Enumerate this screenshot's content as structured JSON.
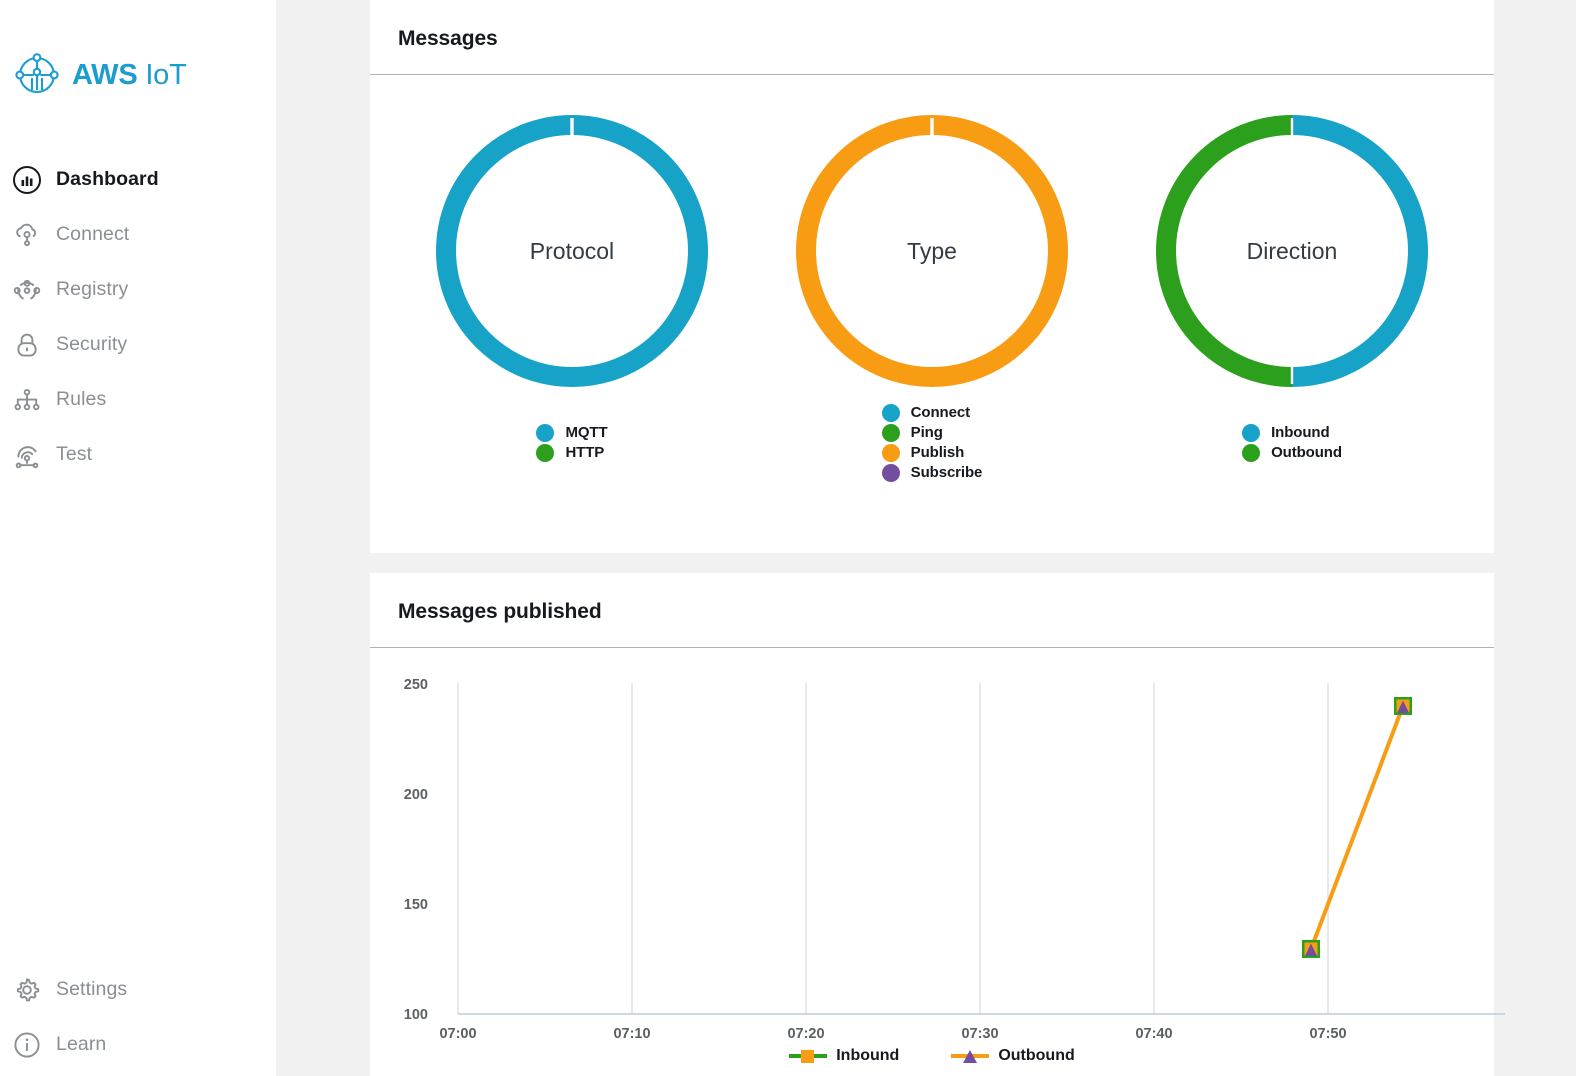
{
  "brand": {
    "primary": "AWS",
    "secondary": "IoT",
    "logo_icon": "aws-iot-logo-icon",
    "color": "#1b9dd1"
  },
  "sidebar": {
    "items": [
      {
        "label": "Dashboard",
        "icon": "dashboard-icon",
        "active": true
      },
      {
        "label": "Connect",
        "icon": "connect-cloud-icon",
        "active": false
      },
      {
        "label": "Registry",
        "icon": "registry-nodes-icon",
        "active": false
      },
      {
        "label": "Security",
        "icon": "security-lock-icon",
        "active": false
      },
      {
        "label": "Rules",
        "icon": "rules-hierarchy-icon",
        "active": false
      },
      {
        "label": "Test",
        "icon": "test-signal-icon",
        "active": false
      }
    ],
    "bottom_items": [
      {
        "label": "Settings",
        "icon": "gear-icon"
      },
      {
        "label": "Learn",
        "icon": "info-circle-icon"
      }
    ]
  },
  "messages_card": {
    "title": "Messages",
    "donuts": [
      {
        "center_label": "Protocol",
        "legend": [
          {
            "label": "MQTT",
            "color": "#17a2c8"
          },
          {
            "label": "HTTP",
            "color": "#2ca01c"
          }
        ]
      },
      {
        "center_label": "Type",
        "legend": [
          {
            "label": "Connect",
            "color": "#17a2c8"
          },
          {
            "label": "Ping",
            "color": "#2ca01c"
          },
          {
            "label": "Publish",
            "color": "#f89c14"
          },
          {
            "label": "Subscribe",
            "color": "#744e9e"
          }
        ]
      },
      {
        "center_label": "Direction",
        "legend": [
          {
            "label": "Inbound",
            "color": "#17a2c8"
          },
          {
            "label": "Outbound",
            "color": "#2ca01c"
          }
        ]
      }
    ]
  },
  "published_card": {
    "title": "Messages published",
    "legend": [
      {
        "label": "Inbound",
        "line_color": "#2ca01c",
        "marker_color": "#f89c14",
        "marker": "square"
      },
      {
        "label": "Outbound",
        "line_color": "#f89c14",
        "marker_color": "#744e9e",
        "marker": "triangle"
      }
    ]
  },
  "chart_data": [
    {
      "type": "pie",
      "title": "Protocol",
      "labels": [
        "MQTT",
        "HTTP"
      ],
      "values": [
        100,
        0
      ],
      "colors": [
        "#17a2c8",
        "#2ca01c"
      ],
      "legend_position": "bottom",
      "donut": true
    },
    {
      "type": "pie",
      "title": "Type",
      "labels": [
        "Connect",
        "Ping",
        "Publish",
        "Subscribe"
      ],
      "values": [
        0,
        0,
        100,
        0
      ],
      "colors": [
        "#17a2c8",
        "#2ca01c",
        "#f89c14",
        "#744e9e"
      ],
      "legend_position": "bottom",
      "donut": true
    },
    {
      "type": "pie",
      "title": "Direction",
      "labels": [
        "Inbound",
        "Outbound"
      ],
      "values": [
        50,
        50
      ],
      "colors": [
        "#17a2c8",
        "#2ca01c"
      ],
      "legend_position": "bottom",
      "donut": true
    },
    {
      "type": "line",
      "title": "Messages published",
      "xlabel": "",
      "ylabel": "",
      "x_ticks": [
        "07:00",
        "07:10",
        "07:20",
        "07:30",
        "07:40",
        "07:50"
      ],
      "y_ticks": [
        100,
        150,
        200,
        250
      ],
      "ylim": [
        100,
        250
      ],
      "grid": true,
      "legend_position": "bottom",
      "series": [
        {
          "name": "Inbound",
          "color": "#2ca01c",
          "marker": "square",
          "marker_color": "#f89c14",
          "x": [
            "07:49",
            "07:54"
          ],
          "values": [
            130,
            241
          ]
        },
        {
          "name": "Outbound",
          "color": "#f89c14",
          "marker": "triangle",
          "marker_color": "#744e9e",
          "x": [
            "07:49",
            "07:54"
          ],
          "values": [
            130,
            241
          ]
        }
      ]
    }
  ]
}
